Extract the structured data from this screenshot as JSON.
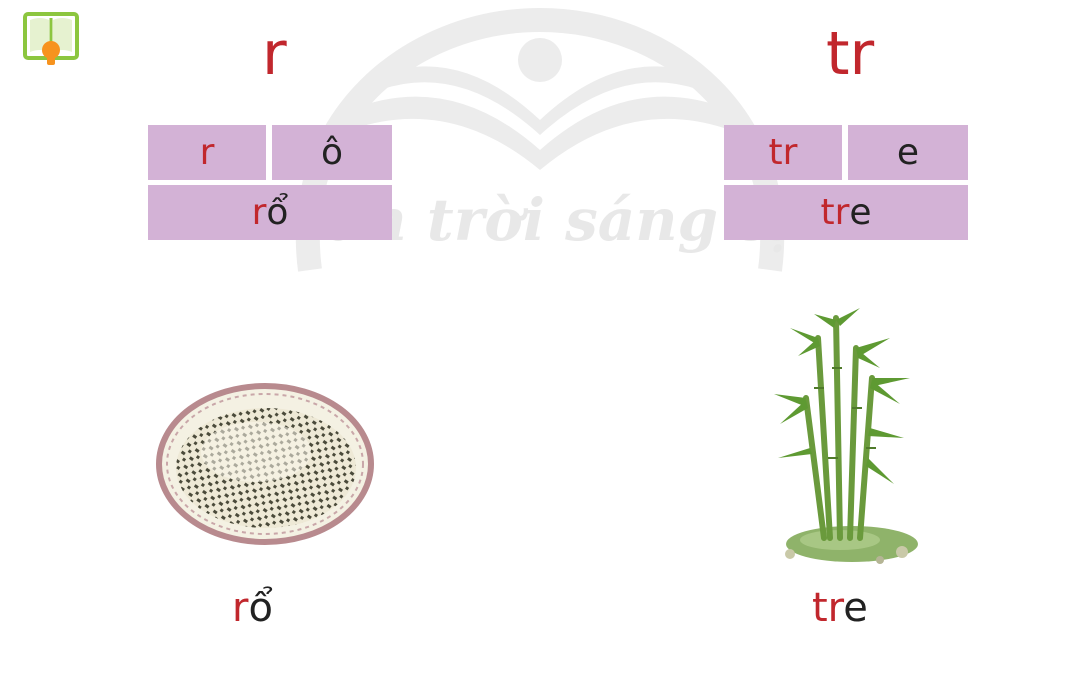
{
  "watermark": {
    "text": "Chân trời sáng tạo"
  },
  "icons": {
    "logo": "book-lightbulb-icon",
    "basket": "basket-image",
    "bamboo": "bamboo-image"
  },
  "colors": {
    "accent_red": "#c1272d",
    "cell_purple": "#d3b2d6",
    "logo_green": "#8cc63f",
    "logo_orange": "#f7931e"
  },
  "left": {
    "heading": "r",
    "cell_consonant": "r",
    "cell_vowel": "ô",
    "word_red": "r",
    "word_rest": "ổ",
    "caption_red": "r",
    "caption_rest": "ổ"
  },
  "right": {
    "heading": "tr",
    "cell_consonant": "tr",
    "cell_vowel": "e",
    "word_red": "tr",
    "word_rest": "e",
    "caption_red": "tr",
    "caption_rest": "e"
  }
}
